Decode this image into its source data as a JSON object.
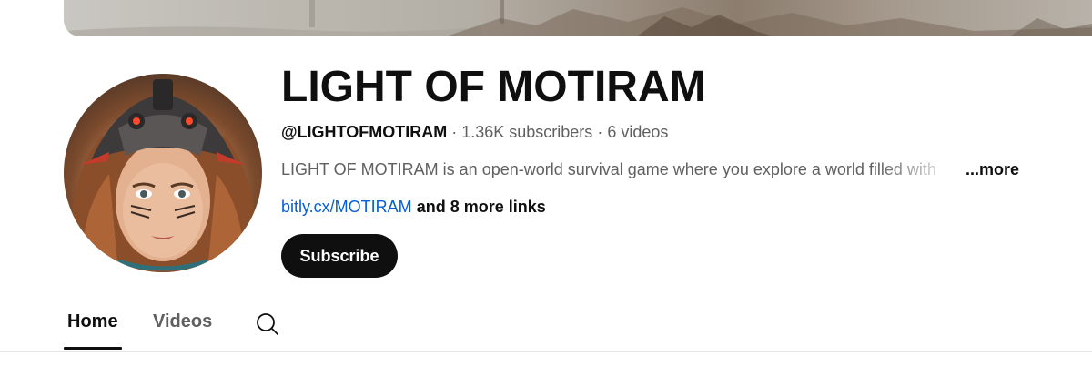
{
  "channel": {
    "title": "LIGHT OF MOTIRAM",
    "handle": "@LIGHTOFMOTIRAM",
    "separator": "·",
    "subscribers": "1.36K subscribers",
    "videos": "6 videos",
    "description": "LIGHT OF MOTIRAM is an open-world survival game where you explore a world filled with",
    "more_label": "...more",
    "link": "bitly.cx/MOTIRAM",
    "more_links": "and 8 more links",
    "subscribe_label": "Subscribe"
  },
  "tabs": [
    {
      "label": "Home",
      "selected": true
    },
    {
      "label": "Videos",
      "selected": false
    }
  ],
  "icons": {
    "search": "search-icon",
    "avatar": "channel-avatar",
    "banner": "channel-banner"
  },
  "colors": {
    "text_primary": "#0f0f0f",
    "text_secondary": "#606060",
    "link": "#065fd4",
    "subscribe_bg": "#0f0f0f",
    "subscribe_text": "#ffffff"
  }
}
